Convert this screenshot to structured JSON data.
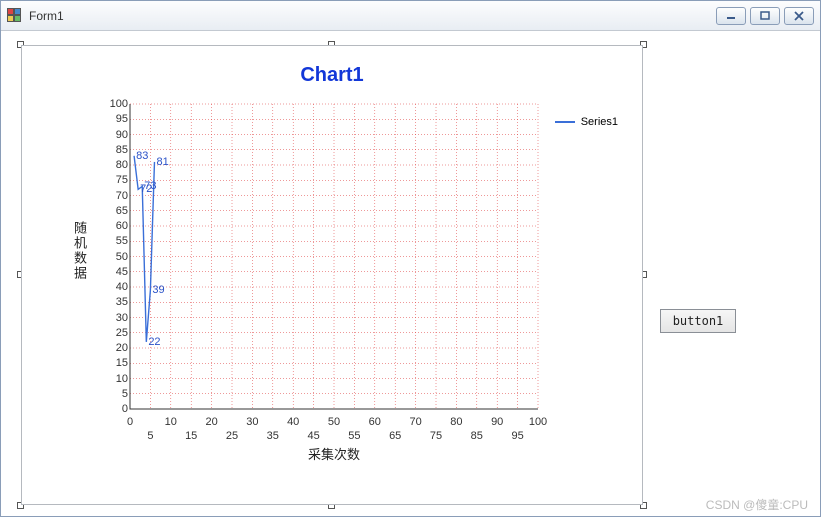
{
  "window": {
    "title": "Form1"
  },
  "button": {
    "label": "button1"
  },
  "legend": {
    "series1": "Series1"
  },
  "watermark": "CSDN @傻童:CPU",
  "chart_data": {
    "type": "line",
    "title": "Chart1",
    "xlabel": "采集次数",
    "ylabel": "随机数据",
    "xlim": [
      0,
      100
    ],
    "ylim": [
      0,
      100
    ],
    "x_ticks_major": [
      0,
      10,
      20,
      30,
      40,
      50,
      60,
      70,
      80,
      90,
      100
    ],
    "x_ticks_minor": [
      5,
      15,
      25,
      35,
      45,
      55,
      65,
      75,
      85,
      95
    ],
    "y_ticks": [
      0,
      5,
      10,
      15,
      20,
      25,
      30,
      35,
      40,
      45,
      50,
      55,
      60,
      65,
      70,
      75,
      80,
      85,
      90,
      95,
      100
    ],
    "series": [
      {
        "name": "Series1",
        "x": [
          1,
          2,
          3,
          4,
          5,
          6
        ],
        "values": [
          83,
          72,
          73,
          22,
          39,
          81
        ]
      }
    ],
    "data_labels": [
      {
        "x": 1,
        "y": 83,
        "text": "83"
      },
      {
        "x": 2,
        "y": 72,
        "text": "72"
      },
      {
        "x": 3,
        "y": 73,
        "text": "73"
      },
      {
        "x": 4,
        "y": 22,
        "text": "22"
      },
      {
        "x": 5,
        "y": 39,
        "text": "39"
      },
      {
        "x": 6,
        "y": 81,
        "text": "81"
      }
    ]
  }
}
